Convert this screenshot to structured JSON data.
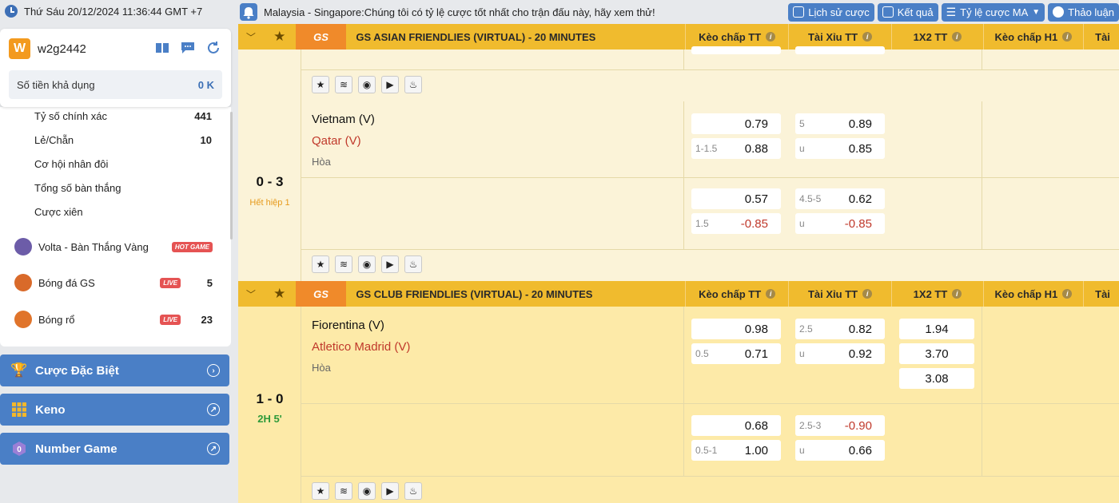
{
  "header": {
    "datetime": "Thứ Sáu 20/12/2024 11:36:44 GMT +7",
    "marquee": "Malaysia - Singapore:Chúng tôi có tỷ lệ cược tốt nhất cho trận đấu này, hãy xem thử!",
    "buttons": [
      "Lịch sử cược",
      "Kết quả",
      "Tỷ lệ cược MA",
      "Thảo luận"
    ]
  },
  "user": {
    "badge": "W",
    "username": "w2g2442",
    "balance_label": "Số tiền khả dụng",
    "balance": "0 K"
  },
  "sidebar": {
    "partial_item": {
      "label": "Tỷ số chính xác",
      "count": "441"
    },
    "sub_items": [
      {
        "label": "Lẻ/Chẵn",
        "count": "10"
      },
      {
        "label": "Cơ hội nhân đôi",
        "count": ""
      },
      {
        "label": "Tổng số bàn thắng",
        "count": ""
      },
      {
        "label": "Cược xiên",
        "count": ""
      }
    ],
    "sports": [
      {
        "label": "Volta - Bàn Thắng Vàng",
        "tag": "HOT GAME",
        "count": ""
      },
      {
        "label": "Bóng đá GS",
        "tag": "LIVE",
        "count": "5"
      },
      {
        "label": "Bóng rổ",
        "tag": "LIVE",
        "count": "23"
      }
    ],
    "buttons": [
      "Cược Đặc Biệt",
      "Keno",
      "Number Game"
    ]
  },
  "columns": [
    "Kèo chấp TT",
    "Tài Xỉu TT",
    "1X2 TT",
    "Kèo chấp H1",
    "Tài"
  ],
  "leagues": [
    {
      "logo": "GS",
      "name": "GS ASIAN FRIENDLIES (VIRTUAL) - 20 MINUTES"
    },
    {
      "logo": "GS",
      "name": "GS CLUB FRIENDLIES (VIRTUAL) - 20 MINUTES"
    }
  ],
  "matches": [
    {
      "home": "Vietnam (V)",
      "away": "Qatar (V)",
      "draw": "Hòa",
      "score": "0 - 3",
      "status": "Hết hiệp 1",
      "rows": [
        {
          "hdp": [
            {
              "line": "",
              "price": "0.79"
            },
            {
              "line": "1-1.5",
              "price": "0.88"
            }
          ],
          "ou": [
            {
              "line": "5",
              "price": "0.89"
            },
            {
              "line": "u",
              "price": "0.85"
            }
          ]
        },
        {
          "hdp": [
            {
              "line": "",
              "price": "0.57"
            },
            {
              "line": "1.5",
              "price": "-0.85"
            }
          ],
          "ou": [
            {
              "line": "4.5-5",
              "price": "0.62"
            },
            {
              "line": "u",
              "price": "-0.85"
            }
          ]
        }
      ]
    },
    {
      "home": "Fiorentina (V)",
      "away": "Atletico Madrid (V)",
      "draw": "Hòa",
      "score": "1 - 0",
      "status": "2H 5'",
      "rows": [
        {
          "hdp": [
            {
              "line": "",
              "price": "0.98"
            },
            {
              "line": "0.5",
              "price": "0.71"
            }
          ],
          "ou": [
            {
              "line": "2.5",
              "price": "0.82"
            },
            {
              "line": "u",
              "price": "0.92"
            }
          ],
          "x12": [
            "1.94",
            "3.70",
            "3.08"
          ]
        },
        {
          "hdp": [
            {
              "line": "",
              "price": "0.68"
            },
            {
              "line": "0.5-1",
              "price": "1.00"
            }
          ],
          "ou": [
            {
              "line": "2.5-3",
              "price": "-0.90"
            },
            {
              "line": "u",
              "price": "0.66"
            }
          ]
        }
      ]
    }
  ],
  "colors": {
    "accent": "#4a7fc6",
    "league_header": "#f0bb2e",
    "negative": "#c0392b",
    "status_halftime": "#e69a1c",
    "status_live": "#2e9a3a"
  }
}
